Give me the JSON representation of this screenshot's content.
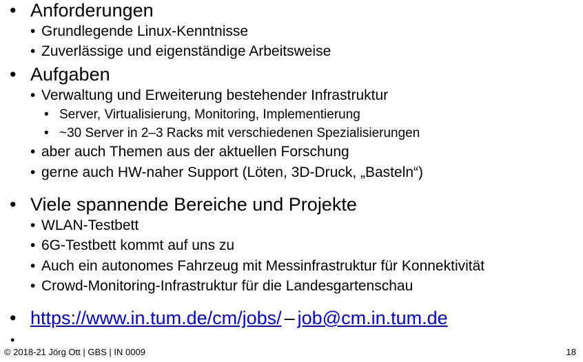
{
  "bullet": "•",
  "sections": {
    "anforderungen": {
      "title": "Anforderungen",
      "items": [
        "Grundlegende Linux-Kenntnisse",
        "Zuverlässige und eigenständige Arbeitsweise"
      ]
    },
    "aufgaben": {
      "title": "Aufgaben",
      "item1": "Verwaltung und Erweiterung bestehender Infrastruktur",
      "sub_items": [
        "Server, Virtualisierung, Monitoring, Implementierung",
        "~30 Server in 2–3 Racks mit verschiedenen Spezialisierungen"
      ],
      "item2": "aber auch Themen aus der aktuellen Forschung",
      "item3": "gerne auch HW-naher Support (Löten, 3D-Druck, „Basteln“)"
    },
    "projekte": {
      "title": "Viele spannende Bereiche und Projekte",
      "items": [
        "WLAN-Testbett",
        "6G-Testbett kommt auf uns zu",
        "Auch ein autonomes Fahrzeug mit Messinfrastruktur für Konnektivität",
        "Crowd-Monitoring-Infrastruktur für die Landesgartenschau"
      ]
    }
  },
  "links": {
    "jobs_url": "https://www.in.tum.de/cm/jobs/",
    "separator": "–",
    "email": "job@cm.in.tum.de"
  },
  "footer": {
    "copyright": "© 2018-21 Jörg Ott | GBS | IN 0009",
    "page_number": "18"
  }
}
